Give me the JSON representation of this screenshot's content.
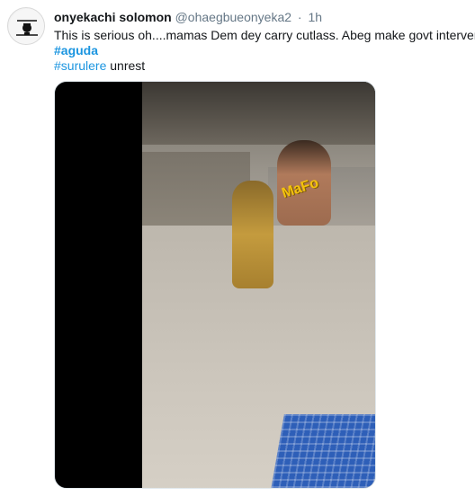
{
  "tweet": {
    "author_name": "onyekachi solomon",
    "handle": "@ohaegbueonyeka2",
    "dot": "·",
    "time": "1h",
    "text": "This is serious oh....mamas Dem dey carry cutlass. Abeg make govt intervene",
    "hashtag_aguda": "#aguda",
    "hashtag_surulere": "#surulere",
    "trailing_word": "unrest"
  },
  "media": {
    "watermark_text": "MaFo"
  },
  "colors": {
    "link": "#1b95e0",
    "muted": "#657786",
    "text": "#14171a"
  }
}
